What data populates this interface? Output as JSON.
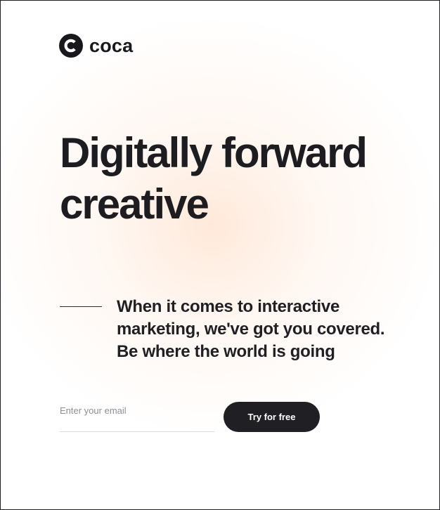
{
  "brand": {
    "name": "coca",
    "icon": "coca-logo-icon",
    "icon_letter": "C"
  },
  "hero": {
    "headline_line1": "Digitally forward",
    "headline_line2": "creative",
    "tagline_line1": "When it comes to interactive",
    "tagline_line2": "marketing, we've got you covered.",
    "tagline_line3": "Be where the world is going"
  },
  "signup": {
    "email_placeholder": "Enter your email",
    "email_value": "",
    "button_label": "Try for free"
  },
  "colors": {
    "text": "#1c1c21",
    "button_bg": "#1f1f24",
    "button_text": "#ffffff",
    "glow": "#ffe5d3"
  }
}
